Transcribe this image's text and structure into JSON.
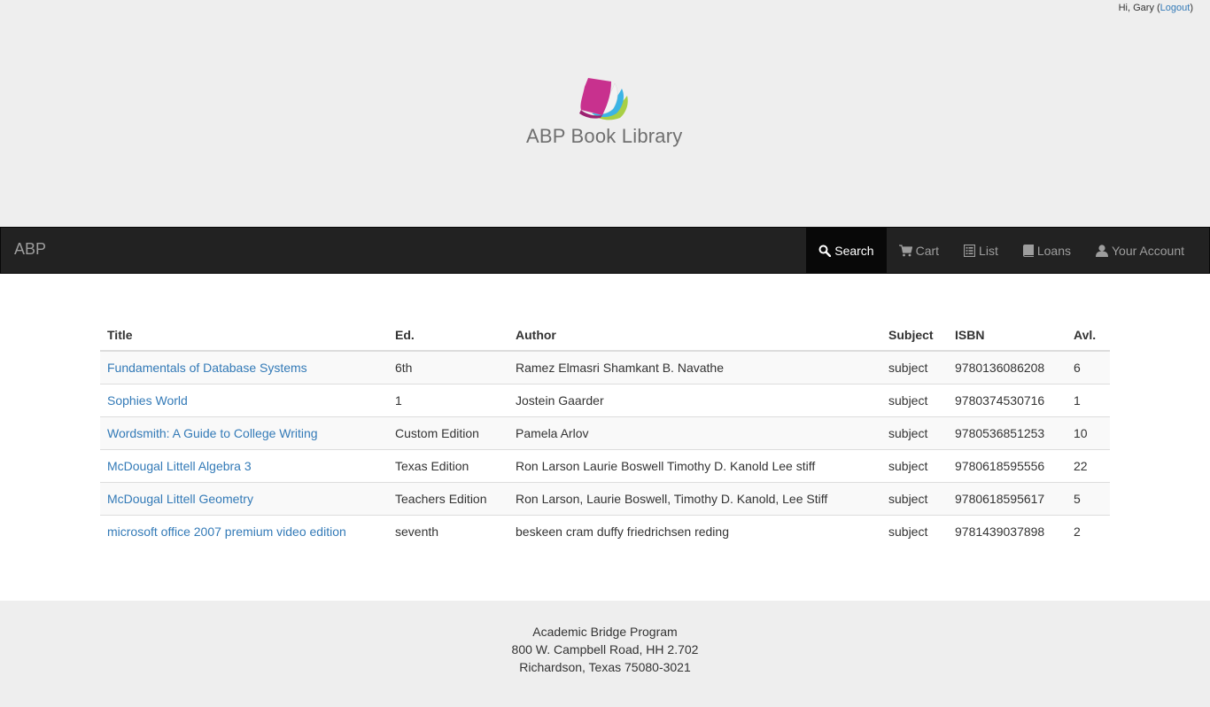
{
  "header": {
    "greeting_prefix": "Hi, Gary (",
    "logout_label": "Logout",
    "greeting_suffix": ")",
    "logo_text": "ABP Book Library",
    "logo_icon": "book-stack-icon"
  },
  "navbar": {
    "brand": "ABP",
    "items": [
      {
        "label": "Search",
        "icon": "search-icon",
        "active": true
      },
      {
        "label": "Cart",
        "icon": "cart-icon",
        "active": false
      },
      {
        "label": "List",
        "icon": "list-icon",
        "active": false
      },
      {
        "label": "Loans",
        "icon": "book-icon",
        "active": false
      },
      {
        "label": "Your Account",
        "icon": "user-icon",
        "active": false
      }
    ]
  },
  "table": {
    "headers": [
      "Title",
      "Ed.",
      "Author",
      "Subject",
      "ISBN",
      "Avl."
    ],
    "rows": [
      {
        "title": "Fundamentals of Database Systems",
        "ed": "6th",
        "author": "Ramez Elmasri Shamkant B. Navathe",
        "subject": "subject",
        "isbn": "9780136086208",
        "avl": "6"
      },
      {
        "title": "Sophies World",
        "ed": "1",
        "author": "Jostein Gaarder",
        "subject": "subject",
        "isbn": "9780374530716",
        "avl": "1"
      },
      {
        "title": "Wordsmith: A Guide to College Writing",
        "ed": "Custom Edition",
        "author": "Pamela Arlov",
        "subject": "subject",
        "isbn": "9780536851253",
        "avl": "10"
      },
      {
        "title": "McDougal Littell Algebra 3",
        "ed": "Texas Edition",
        "author": "Ron Larson Laurie Boswell Timothy D. Kanold Lee stiff",
        "subject": "subject",
        "isbn": "9780618595556",
        "avl": "22"
      },
      {
        "title": "McDougal Littell Geometry",
        "ed": "Teachers Edition",
        "author": "Ron Larson, Laurie Boswell, Timothy D. Kanold, Lee Stiff",
        "subject": "subject",
        "isbn": "9780618595617",
        "avl": "5"
      },
      {
        "title": "microsoft office 2007 premium video edition",
        "ed": "seventh",
        "author": "beskeen cram duffy friedrichsen reding",
        "subject": "subject",
        "isbn": "9781439037898",
        "avl": "2"
      }
    ]
  },
  "footer": {
    "line1": "Academic Bridge Program",
    "line2": "800 W. Campbell Road, HH 2.702",
    "line3": "Richardson, Texas 75080-3021"
  },
  "colors": {
    "header_bg": "#eeeeee",
    "navbar_bg": "#222222",
    "navbar_active_bg": "#080808",
    "link": "#337ab7",
    "logo_magenta": "#c8318e",
    "logo_blue": "#3bb4e5",
    "logo_green": "#a8cf45"
  }
}
